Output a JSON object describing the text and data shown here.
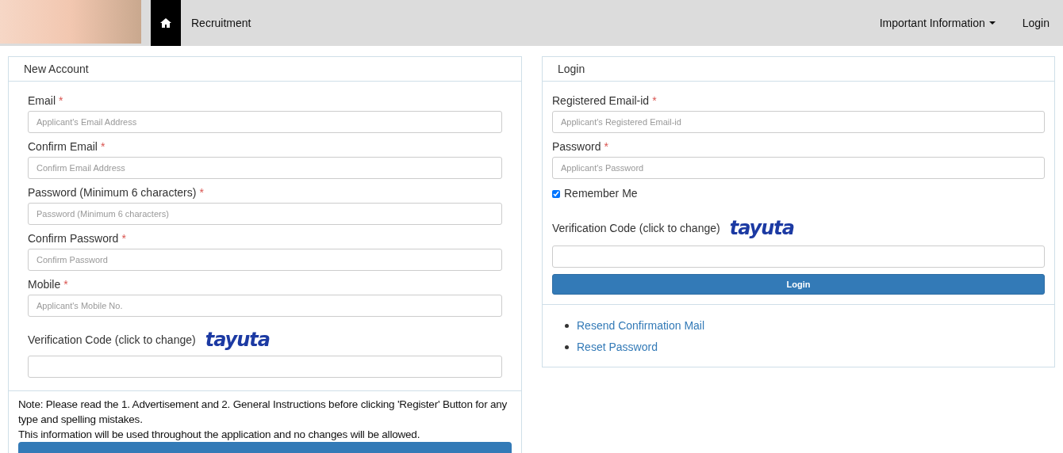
{
  "navbar": {
    "links": [
      {
        "label": "Recruitment"
      }
    ],
    "right_links": [
      {
        "label": "Important Information",
        "dropdown": true
      },
      {
        "label": "Login",
        "dropdown": false
      }
    ]
  },
  "new_account": {
    "title": "New Account",
    "fields": [
      {
        "label": "Email",
        "required_mark": "*",
        "placeholder": "Applicant's Email Address"
      },
      {
        "label": "Confirm Email",
        "required_mark": "*",
        "placeholder": "Confirm Email Address"
      },
      {
        "label": "Password (Minimum 6 characters)",
        "required_mark": "*",
        "placeholder": "Password (Minimum 6 characters)"
      },
      {
        "label": "Confirm Password",
        "required_mark": "*",
        "placeholder": "Confirm Password"
      },
      {
        "label": "Mobile",
        "required_mark": "*",
        "placeholder": "Applicant's Mobile No."
      }
    ],
    "verification": {
      "label": "Verification Code (click to change)",
      "captcha": "tayuta"
    },
    "note": [
      "Note: Please read the 1. Advertisement and 2. General Instructions before clicking 'Register' Button for any type and spelling mistakes.",
      "This information will be used throughout the application and no changes will be allowed."
    ]
  },
  "login": {
    "title": "Login",
    "fields": [
      {
        "label": "Registered Email-id",
        "required_mark": "*",
        "placeholder": "Applicant's Registered Email-id"
      },
      {
        "label": "Password",
        "required_mark": "*",
        "placeholder": "Applicant's Password"
      }
    ],
    "remember": {
      "label": "Remember Me",
      "checked": true
    },
    "verification": {
      "label": "Verification Code (click to change)",
      "captcha": "tayuta"
    },
    "button": "Login",
    "links": [
      "Resend Confirmation Mail",
      "Reset Password"
    ]
  }
}
